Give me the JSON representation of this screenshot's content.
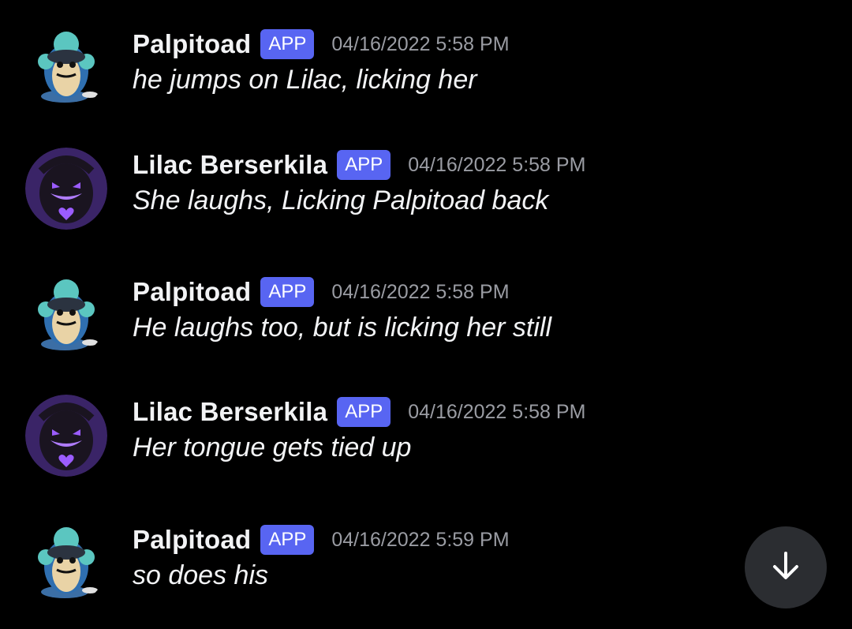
{
  "messages": [
    {
      "author": "Palpitoad",
      "avatar_icon": "palpitoad-avatar-icon",
      "badge": "APP",
      "timestamp": "04/16/2022 5:58 PM",
      "text": "he jumps on Lilac, licking her"
    },
    {
      "author": "Lilac Berserkila",
      "avatar_icon": "lilac-avatar-icon",
      "badge": "APP",
      "timestamp": "04/16/2022 5:58 PM",
      "text": "She laughs, Licking Palpitoad back"
    },
    {
      "author": "Palpitoad",
      "avatar_icon": "palpitoad-avatar-icon",
      "badge": "APP",
      "timestamp": "04/16/2022 5:58 PM",
      "text": "He laughs too, but is licking her still"
    },
    {
      "author": "Lilac Berserkila",
      "avatar_icon": "lilac-avatar-icon",
      "badge": "APP",
      "timestamp": "04/16/2022 5:58 PM",
      "text": "Her tongue gets tied up"
    },
    {
      "author": "Palpitoad",
      "avatar_icon": "palpitoad-avatar-icon",
      "badge": "APP",
      "timestamp": "04/16/2022 5:59 PM",
      "text": "so does his"
    }
  ],
  "scroll_button": {
    "icon": "arrow-down-icon"
  },
  "colors": {
    "background": "#000000",
    "badge": "#5865f2",
    "username": "#f2f3f5",
    "timestamp": "#9a9ca3",
    "scroll_button_bg": "#2b2d31"
  }
}
